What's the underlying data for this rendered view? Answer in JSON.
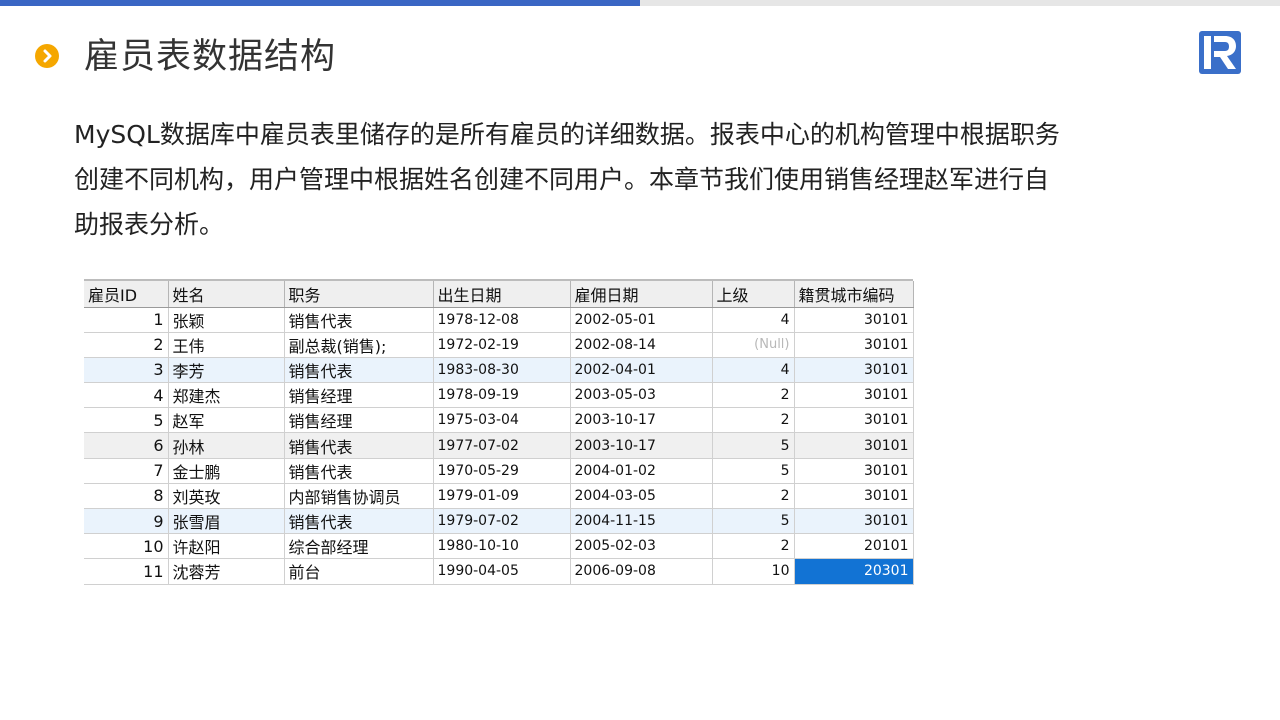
{
  "slide": {
    "title": "雇员表数据结构",
    "paragraph_lines": [
      "MySQL数据库中雇员表里储存的是所有雇员的详细数据。报表中心的机构管理中根据职务",
      "创建不同机构，用户管理中根据姓名创建不同用户。本章节我们使用销售经理赵军进行自",
      "助报表分析。"
    ]
  },
  "colors": {
    "accent_bar": "#3a66c4",
    "bullet": "#f5a700",
    "logo": "#3a6fc9",
    "row_highlight": "#eaf3fc",
    "selected_cell": "#1273d4"
  },
  "table": {
    "headers": [
      "雇员ID",
      "姓名",
      "职务",
      "出生日期",
      "雇佣日期",
      "上级",
      "籍贯城市编码"
    ],
    "rows": [
      [
        "1",
        "张颖",
        "销售代表",
        "1978-12-08",
        "2002-05-01",
        "4",
        "30101"
      ],
      [
        "2",
        "王伟",
        "副总裁(销售);",
        "1972-02-19",
        "2002-08-14",
        "(Null)",
        "30101"
      ],
      [
        "3",
        "李芳",
        "销售代表",
        "1983-08-30",
        "2002-04-01",
        "4",
        "30101"
      ],
      [
        "4",
        "郑建杰",
        "销售经理",
        "1978-09-19",
        "2003-05-03",
        "2",
        "30101"
      ],
      [
        "5",
        "赵军",
        "销售经理",
        "1975-03-04",
        "2003-10-17",
        "2",
        "30101"
      ],
      [
        "6",
        "孙林",
        "销售代表",
        "1977-07-02",
        "2003-10-17",
        "5",
        "30101"
      ],
      [
        "7",
        "金士鹏",
        "销售代表",
        "1970-05-29",
        "2004-01-02",
        "5",
        "30101"
      ],
      [
        "8",
        "刘英玫",
        "内部销售协调员",
        "1979-01-09",
        "2004-03-05",
        "2",
        "30101"
      ],
      [
        "9",
        "张雪眉",
        "销售代表",
        "1979-07-02",
        "2004-11-15",
        "5",
        "30101"
      ],
      [
        "10",
        "许赵阳",
        "综合部经理",
        "1980-10-10",
        "2005-02-03",
        "2",
        "20101"
      ],
      [
        "11",
        "沈蓉芳",
        "前台",
        "1990-04-05",
        "2006-09-08",
        "10",
        "20301"
      ]
    ]
  }
}
